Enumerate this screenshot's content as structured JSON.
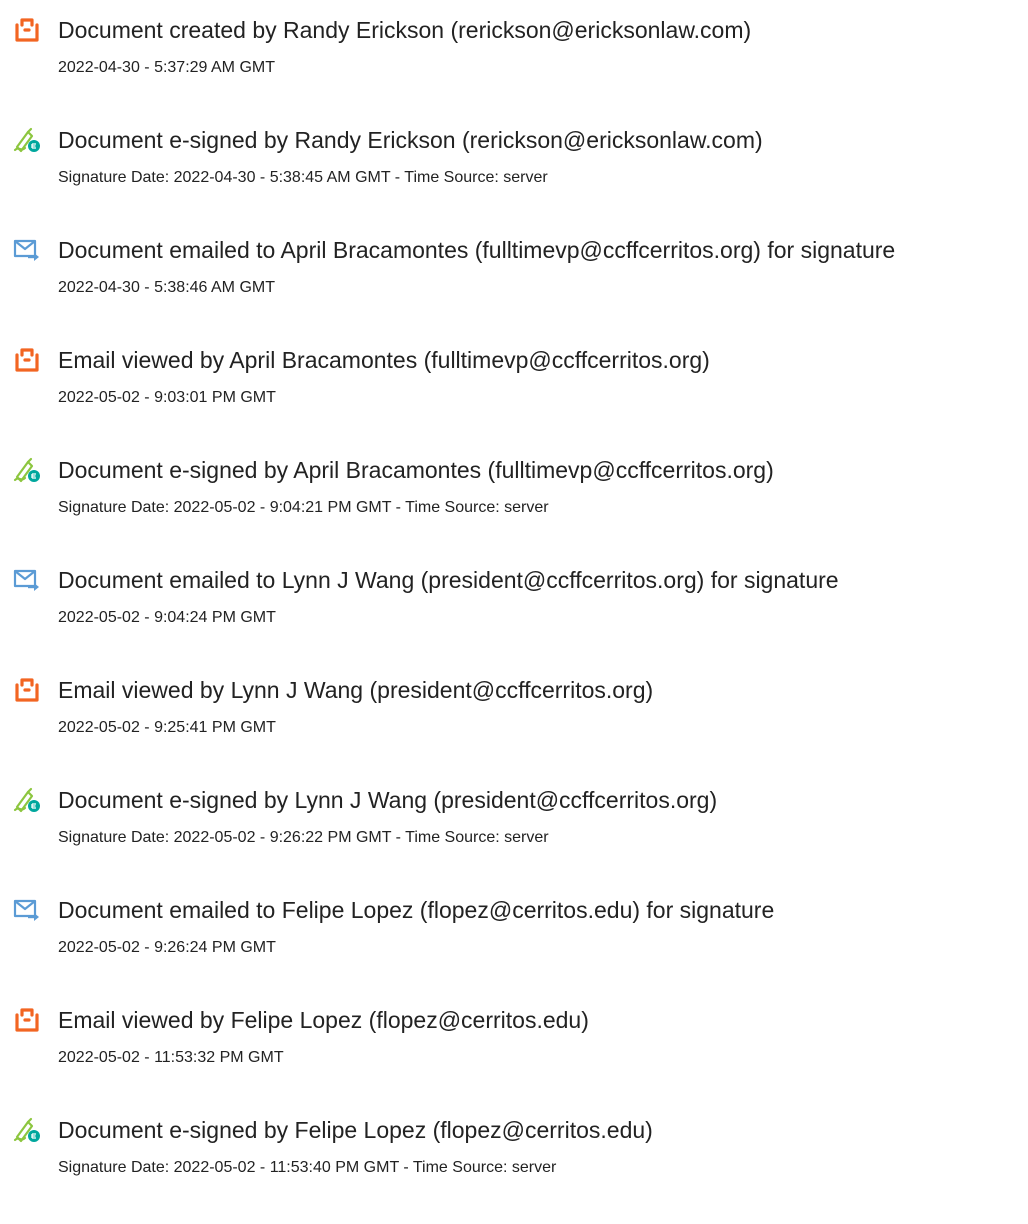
{
  "colors": {
    "pdf_icon": "#f26522",
    "sign_icon": "#8dc63f",
    "sign_badge": "#00a79d",
    "email_icon": "#5b9bd5",
    "text": "#222222"
  },
  "events": [
    {
      "icon": "pdf-icon",
      "title": "Document created by Randy Erickson (rerickson@ericksonlaw.com)",
      "detail": "2022-04-30 - 5:37:29 AM GMT"
    },
    {
      "icon": "signature-icon",
      "title": "Document e-signed by Randy Erickson (rerickson@ericksonlaw.com)",
      "detail": "Signature Date: 2022-04-30 - 5:38:45 AM GMT - Time Source: server"
    },
    {
      "icon": "email-icon",
      "title": "Document emailed to April Bracamontes (fulltimevp@ccffcerritos.org) for signature",
      "detail": "2022-04-30 - 5:38:46 AM GMT"
    },
    {
      "icon": "pdf-icon",
      "title": "Email viewed by April Bracamontes (fulltimevp@ccffcerritos.org)",
      "detail": "2022-05-02 - 9:03:01 PM GMT"
    },
    {
      "icon": "signature-icon",
      "title": "Document e-signed by April Bracamontes (fulltimevp@ccffcerritos.org)",
      "detail": "Signature Date: 2022-05-02 - 9:04:21 PM GMT - Time Source: server"
    },
    {
      "icon": "email-icon",
      "title": "Document emailed to Lynn J Wang (president@ccffcerritos.org) for signature",
      "detail": "2022-05-02 - 9:04:24 PM GMT"
    },
    {
      "icon": "pdf-icon",
      "title": "Email viewed by Lynn J Wang (president@ccffcerritos.org)",
      "detail": "2022-05-02 - 9:25:41 PM GMT"
    },
    {
      "icon": "signature-icon",
      "title": "Document e-signed by Lynn J Wang (president@ccffcerritos.org)",
      "detail": "Signature Date: 2022-05-02 - 9:26:22 PM GMT - Time Source: server"
    },
    {
      "icon": "email-icon",
      "title": "Document emailed to Felipe Lopez (flopez@cerritos.edu) for signature",
      "detail": "2022-05-02 - 9:26:24 PM GMT"
    },
    {
      "icon": "pdf-icon",
      "title": "Email viewed by Felipe Lopez (flopez@cerritos.edu)",
      "detail": "2022-05-02 - 11:53:32 PM GMT"
    },
    {
      "icon": "signature-icon",
      "title": "Document e-signed by Felipe Lopez (flopez@cerritos.edu)",
      "detail": "Signature Date: 2022-05-02 - 11:53:40 PM GMT - Time Source: server"
    }
  ]
}
